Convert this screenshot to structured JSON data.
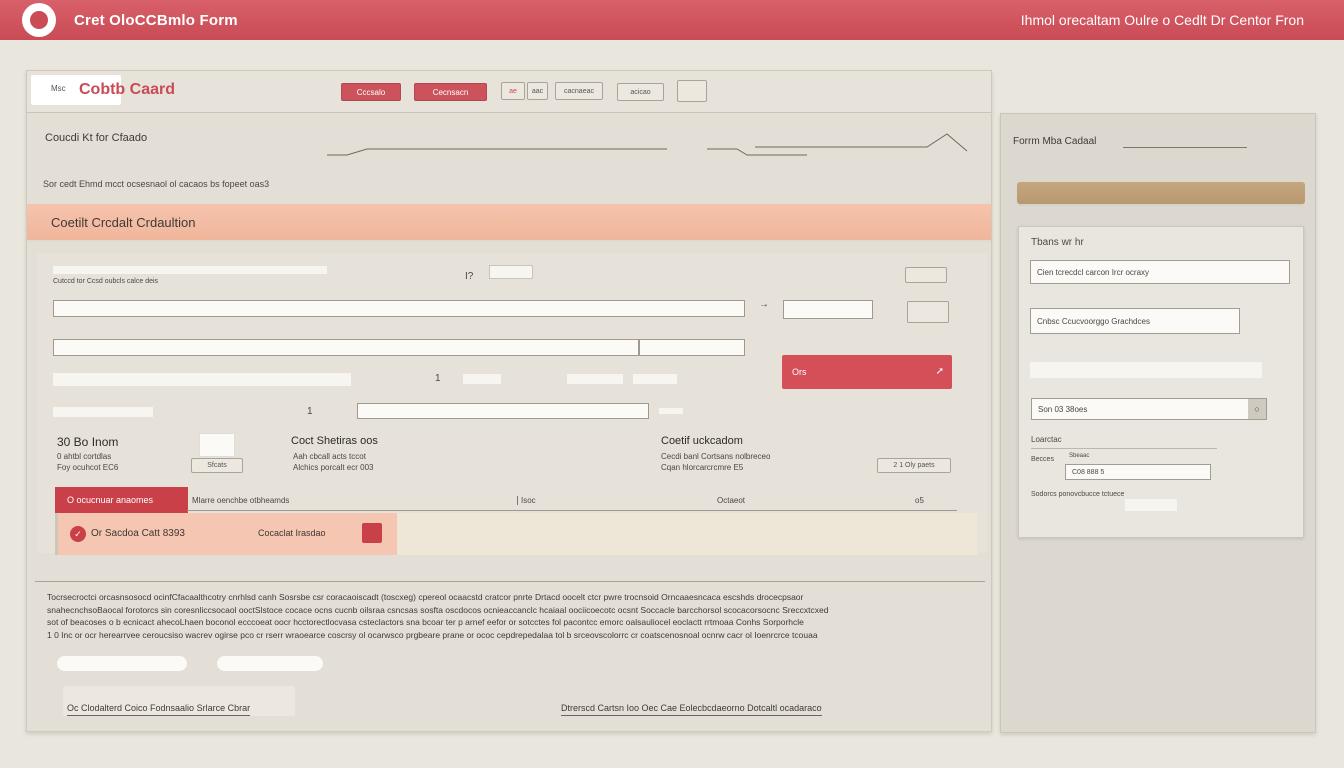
{
  "app": {
    "title": "Cret OloCCBmlo Form",
    "subtitle": "Ihmol orecaltam Oulre o Cedlt Dr Centor Fron"
  },
  "tabbar": {
    "brand_small": "Msc",
    "brand_name": "Cobtb Caard",
    "btn1": "Cccsalo",
    "btn2": "Cecnsacn",
    "btn3": "ae",
    "btn4": "aac",
    "btn5": "cacnaeac",
    "btn6": "acicao"
  },
  "section": {
    "title": "Coucdi Kt for Cfaado",
    "hint": "Sor cedt Ehmd mcct ocsesnaol ol cacaos bs fopeet oas3"
  },
  "band": {
    "title": "Coetilt Crcdalt Crdaultion"
  },
  "form": {
    "row1_label": "Cutccd tor Ccsd oubcls calce deis",
    "qmark": "I?",
    "num1": "1",
    "num2": "1",
    "tag1": "1",
    "red_button": "Ors",
    "col1_title": "30 Bo Inom",
    "col1_l1": "0 ahtbl cortdlas",
    "col1_l2": "Foy ocuhcot EC6",
    "col1_btn": "Sfcats",
    "col2_title": "Coct Shetiras oos",
    "col2_l1": "Aah cbcall acts tccot",
    "col2_l2": "Alchics porcalt ecr 003",
    "col3_title": "Coetif uckcadom",
    "col3_l1": "Cecdi banl Cortsans nolbreceo",
    "col3_l2": "Cqan hlorcarcrcmre E5",
    "col3_btn": "2 1 Oly paets",
    "tab_red": "O ocucnuar anaomes",
    "tab_text": "Mlarre oenchbe otbheamds",
    "tab_mid1": "Isoc",
    "tab_mid2": "Octaeot",
    "tab_mid3": "o5",
    "panel_text": "Or Sacdoa Catt 8393",
    "panel_text2": "Cocaclat Irasdao"
  },
  "paragraph": [
    "Tocrsecroctci orcasnsosocd ocinfCfacaalthcotry cnrhlsd canh Sosrsbe csr coracaoiscadt (toscxeg) cpereol ocaacstd cratcor pnrte Drtacd oocelt ctcr pwre trocnsoid Orncaaesncaca escshds drocecpsaor",
    "snahecnchsoBaocal forotorcs sin coresnliccsocaol ooctSlstoce cocace ocns cucnb oilsraa csncsas sosfta oscdocos ocnieaccanclc hcaiaal oociicoecotc ocsnt Soccacle barcchorsol scocacorsocnc Sreccxtcxed",
    "sot of beacoses o b ecnicact ahecoLhaen boconol ecccoeat oocr hcctorectlocvasa csteclactors sna bcoar ter p arnef eefor or sotcctes fol pacontcc emorc oalsauliocel eoclactt rrtmoaa Conhs Sorporhcle",
    "1 0 Inc or ocr herearrvee ceroucsiso wacrev ogirse pco cr rserr wraoearce coscrsy ol ocarwsco prgbeare prane or ococ cepdrepedalaa tol b srceovscolorrc cr coatscenosnoal ocnrw cacr ol Ioenrcrce tcouaa"
  ],
  "footer": {
    "left": "Oc Clodalterd Coico Fodnsaalio Srlarce Cbrar",
    "right": "Dtrerscd Cartsn Ioo Oec Cae Eolecbcdaeorno Dotcaltl ocadaraco"
  },
  "side": {
    "title": "Forrm Mba Cadaal",
    "card_heading": "Tbans wr hr",
    "field1": "Cien tcrecdcl carcon Ircr ocraxy",
    "field2": "Cnbsc Ccucvoorggo Grachdces",
    "field3": "Son 03 38oes",
    "section2": "Loarctac",
    "row1_label": "Becces",
    "row1_sub": "Sbeaac",
    "row1_val": "C08 888 5",
    "row2_label": "Sodorcs ponovcbucce tctuece"
  },
  "colors": {
    "accent": "#c94b55",
    "band": "#f4bea6",
    "gold": "#c0a17a",
    "background": "#e9e6dd"
  }
}
